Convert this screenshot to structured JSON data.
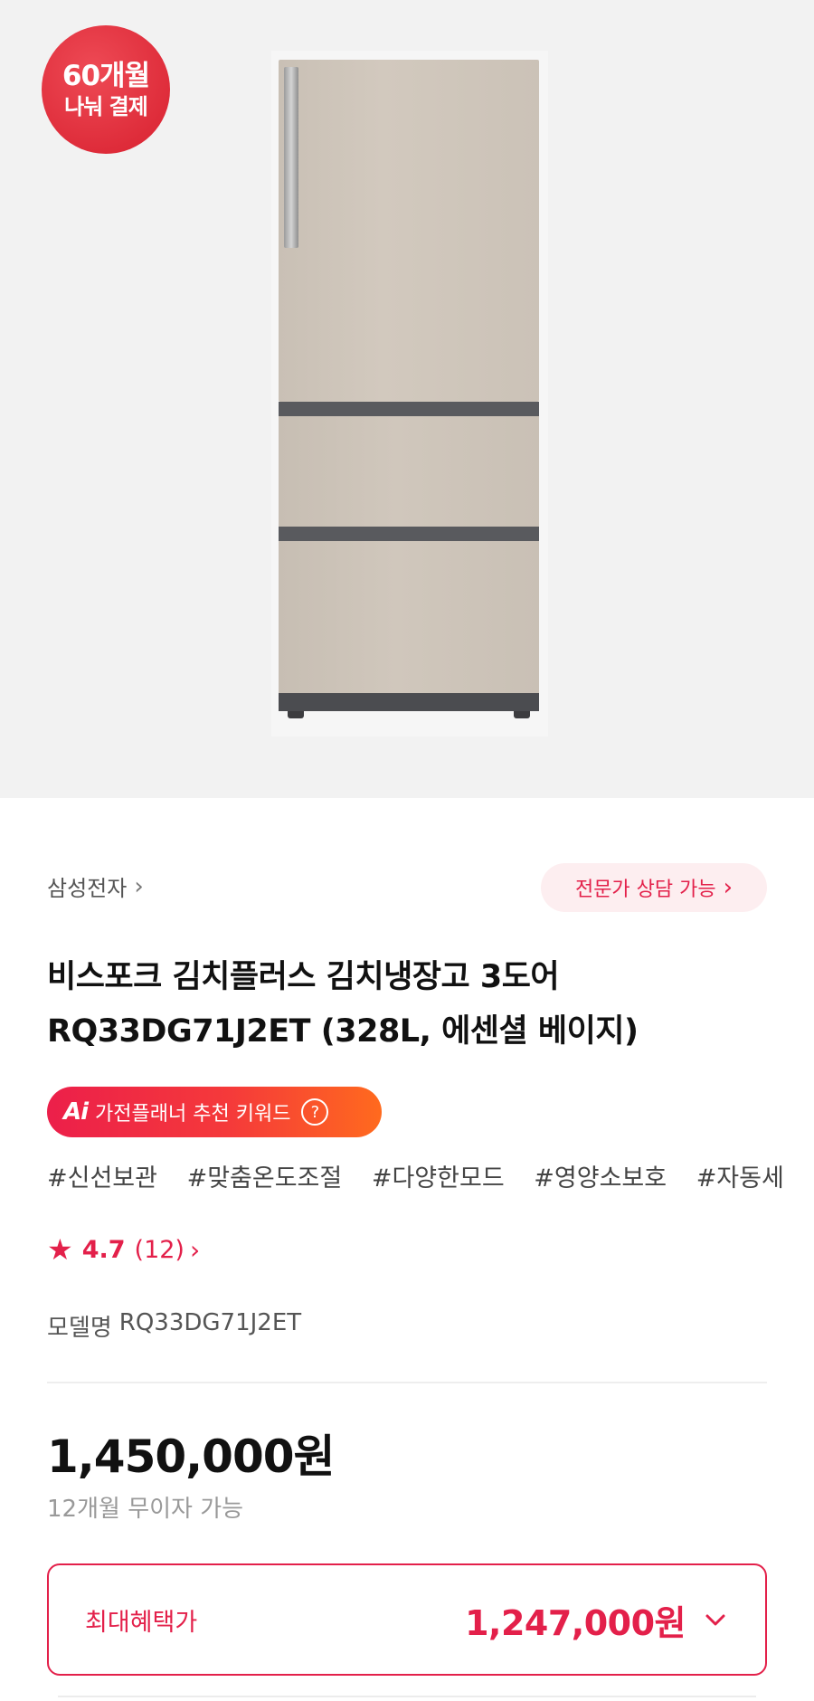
{
  "hero": {
    "badge_line1": "60개월",
    "badge_line2": "나눠 결제",
    "image_alt": "refrigerator-image"
  },
  "brand": {
    "name": "삼성전자",
    "chevron": "›"
  },
  "consult": {
    "label": "전문가 상담 가능",
    "chevron": "›"
  },
  "product": {
    "title": "비스포크 김치플러스 김치냉장고 3도어 RQ33DG71J2ET (328L, 에센셜 베이지)",
    "model_label": "모델명",
    "model_value": "RQ33DG71J2ET"
  },
  "ai_keyword": {
    "icon_text": "Ai",
    "label": "가전플래너 추천 키워드",
    "help": "?"
  },
  "tags": [
    "#신선보관",
    "#맞춤온도조절",
    "#다양한모드",
    "#영양소보호",
    "#자동세"
  ],
  "rating": {
    "star": "★",
    "score": "4.7",
    "count": "(12)",
    "chevron": "›"
  },
  "pricing": {
    "price": "1,450,000원",
    "installment": "12개월 무이자 가능",
    "benefit_label": "최대혜택가",
    "benefit_price": "1,247,000원"
  },
  "colors": {
    "accent": "#e3204a",
    "badge": "#e02a36",
    "background_hero": "#f2f2f2"
  },
  "icons": {
    "star": "star-icon",
    "chevron": "chevron-right-icon",
    "dropdown": "chevron-down-icon",
    "help": "help-circle-icon"
  }
}
